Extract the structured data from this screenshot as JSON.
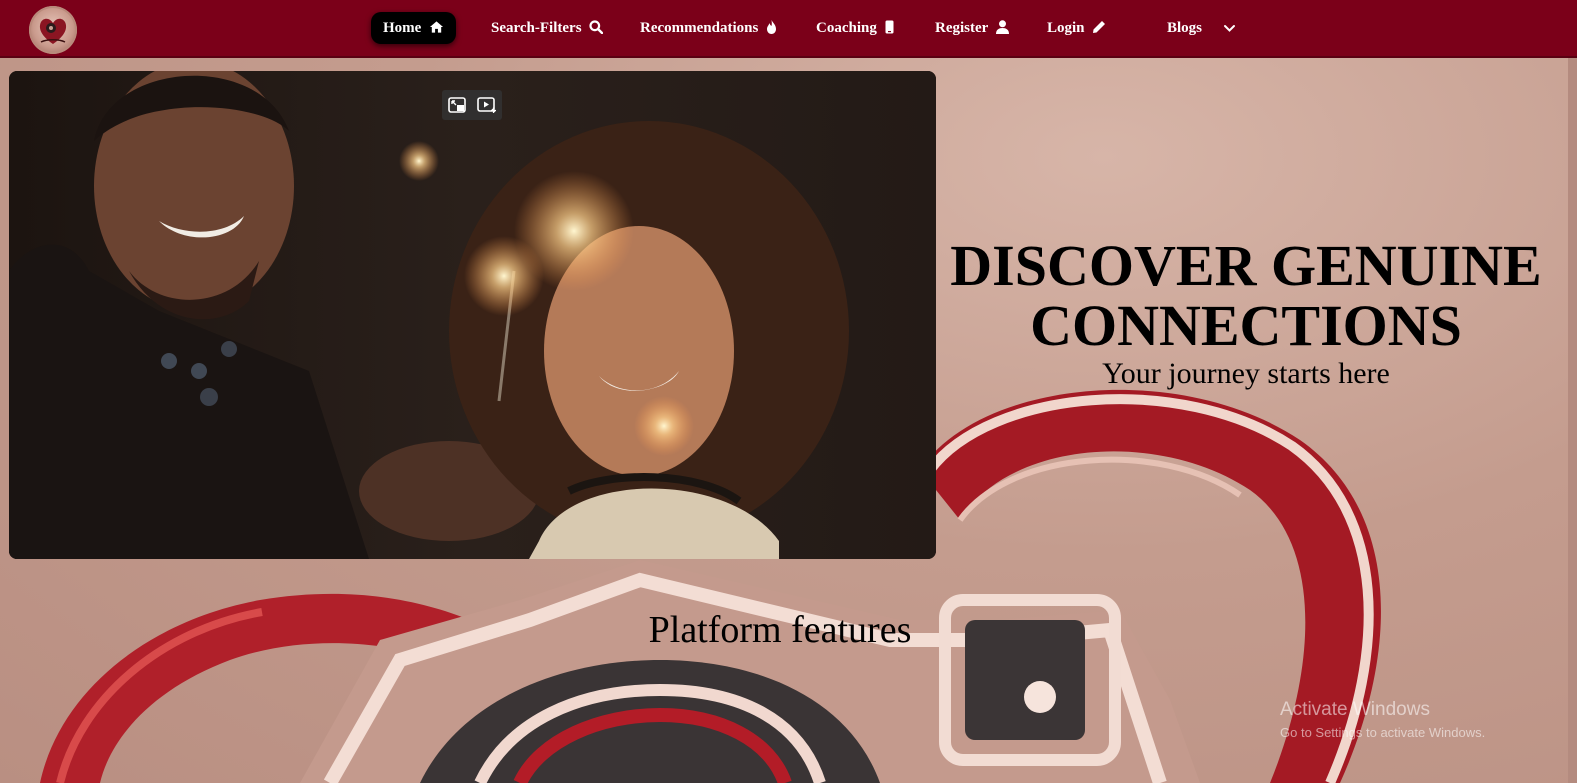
{
  "nav": {
    "items": [
      {
        "label": "Home",
        "icon": "home-icon"
      },
      {
        "label": "Search-Filters",
        "icon": "search-icon"
      },
      {
        "label": "Recommendations",
        "icon": "fire-icon"
      },
      {
        "label": "Coaching",
        "icon": "phone-icon"
      },
      {
        "label": "Register",
        "icon": "user-icon"
      },
      {
        "label": "Login",
        "icon": "pencil-icon"
      },
      {
        "label": "Blogs",
        "icon": "chevron-down-icon"
      }
    ],
    "active": "Home"
  },
  "hero": {
    "title": "DISCOVER GENUINE CONNECTIONS",
    "subtitle": "Your journey starts here"
  },
  "features": {
    "title": "Platform features"
  },
  "os_watermark": {
    "line1": "Activate Windows",
    "line2": "Go to Settings to activate Windows."
  },
  "colors": {
    "nav_bg": "#7b0019",
    "active_bg": "#000000",
    "page_bg": "#c9a193"
  }
}
